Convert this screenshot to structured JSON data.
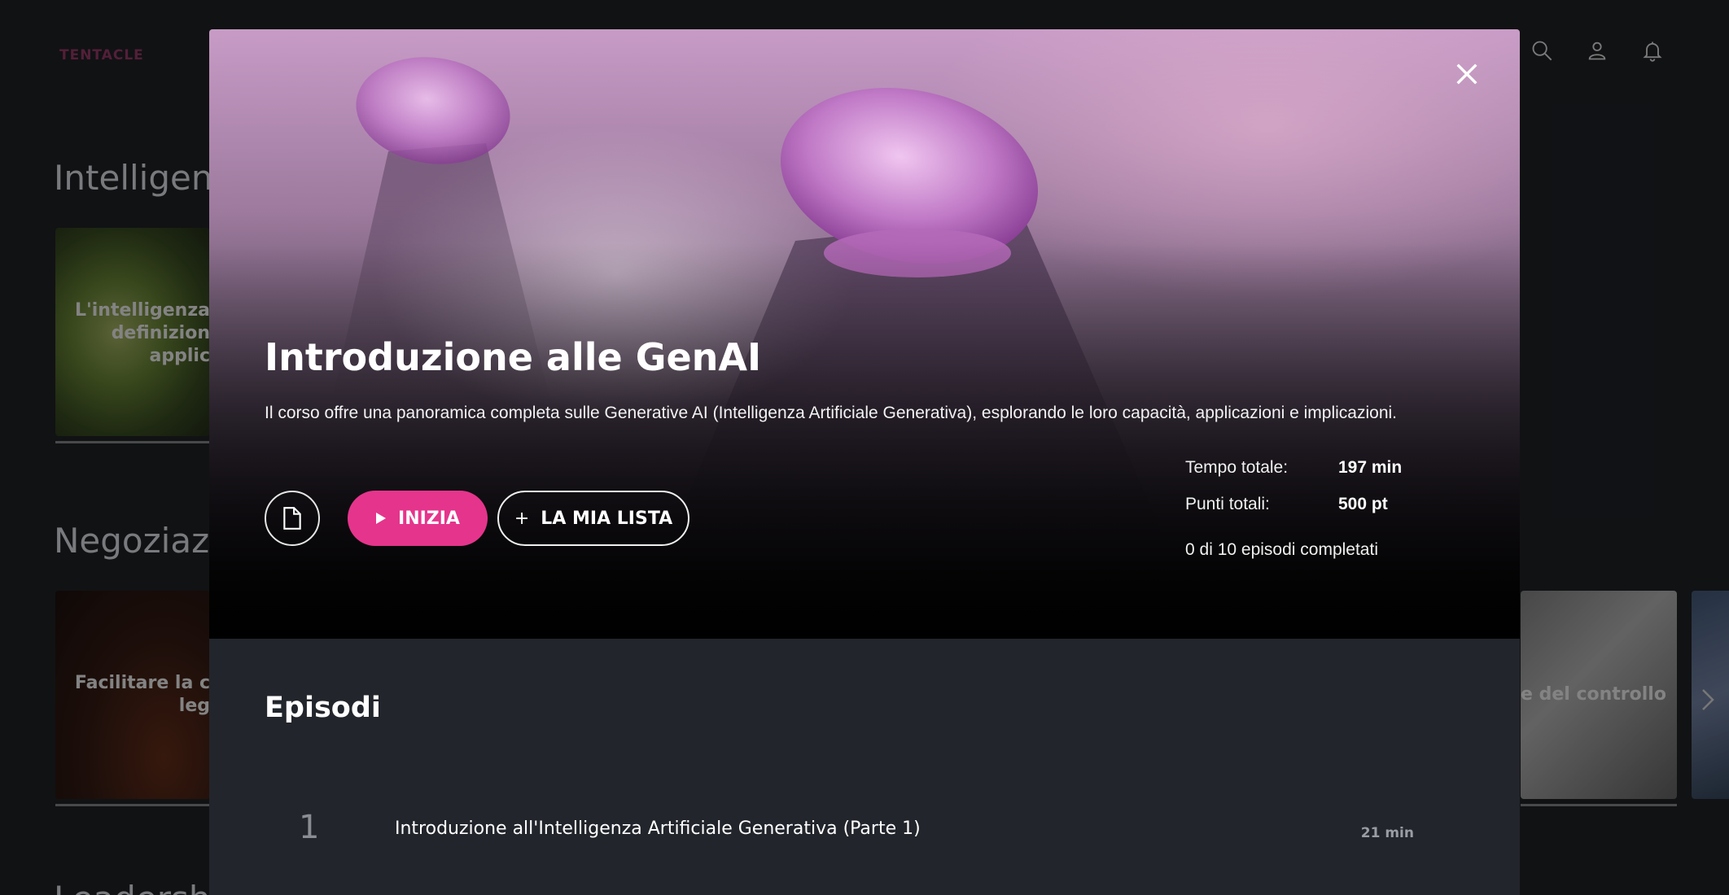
{
  "app": {
    "logo": "TENTACLE",
    "header_icons": [
      "search-icon",
      "profile-icon",
      "bell-icon"
    ]
  },
  "background": {
    "rows": [
      {
        "title": "Intelligen",
        "card_label": "L'intelligenza\ndefinizion\napplic"
      },
      {
        "title": "Negoziazi",
        "card_label": "Facilitare la c\nleg",
        "right_card_label": "e del controllo"
      },
      {
        "title": "Leadershi"
      }
    ]
  },
  "modal": {
    "title": "Introduzione alle GenAI",
    "description": "Il corso offre una panoramica completa sulle Generative AI (Intelligenza Artificiale Generativa), esplorando le loro capacità, applicazioni e implicazioni.",
    "buttons": {
      "start": "INIZIA",
      "my_list": "LA MIA LISTA",
      "my_list_prefix": "+"
    },
    "stats": {
      "total_time_label": "Tempo totale:",
      "total_time_value": "197 min",
      "total_points_label": "Punti totali:",
      "total_points_value": "500 pt",
      "progress_text": "0 di 10 episodi completati"
    },
    "episodes": {
      "heading": "Episodi",
      "items": [
        {
          "number": "1",
          "title": "Introduzione all'Intelligenza Artificiale Generativa (Parte 1)",
          "duration": "21 min"
        }
      ]
    }
  },
  "colors": {
    "accent": "#e5348c",
    "background": "#16181c",
    "modal_bg": "#22252b"
  }
}
